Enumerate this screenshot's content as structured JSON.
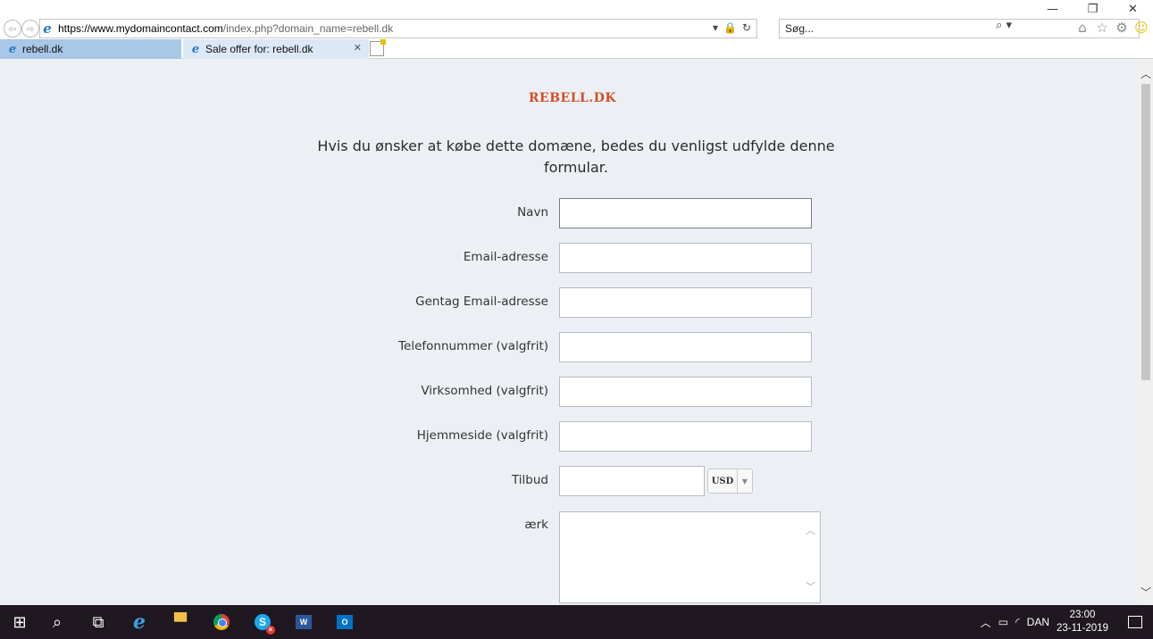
{
  "window": {
    "minimize": "—",
    "restore": "❐",
    "close": "✕"
  },
  "browser": {
    "url_host": "https://www.mydomaincontact.com",
    "url_path": "/index.php?domain_name=rebell.dk",
    "search_placeholder": "Søg...",
    "tabs": [
      {
        "label": "rebell.dk"
      },
      {
        "label": "Sale offer for: rebell.dk"
      }
    ]
  },
  "page": {
    "domain_title": "REBELL.DK",
    "intro": "Hvis du ønsker at købe dette domæne, bedes du venligst udfylde denne formular.",
    "fields": {
      "name": "Navn",
      "email": "Email-adresse",
      "email_repeat": "Gentag Email-adresse",
      "phone": "Telefonnummer (valgfrit)",
      "company": "Virksomhed (valgfrit)",
      "website": "Hjemmeside (valgfrit)",
      "offer": "Tilbud",
      "remark": "ærk"
    },
    "currency": "USD"
  },
  "taskbar": {
    "language": "DAN",
    "time": "23:00",
    "date": "23-11-2019"
  }
}
